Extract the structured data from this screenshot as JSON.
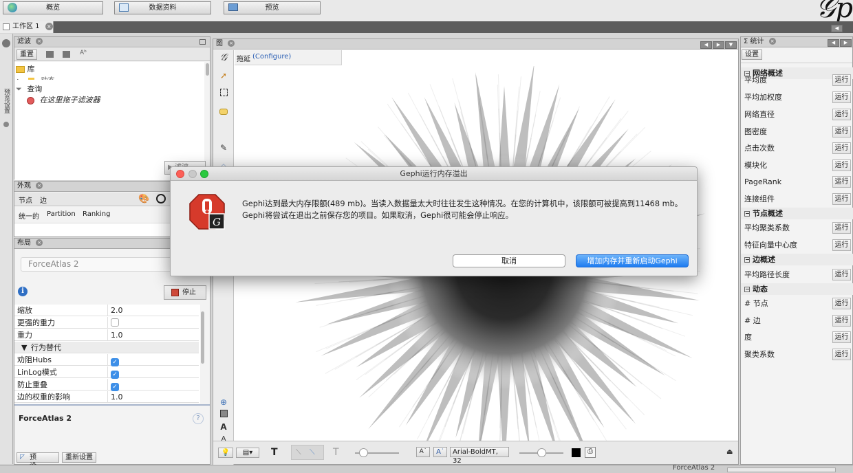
{
  "toolbar": {
    "overview": "概览",
    "data_lab": "数据资料",
    "preview": "预览"
  },
  "workspace": {
    "tab": "工作区 1"
  },
  "left_strip": {
    "label": "预览设置"
  },
  "filters": {
    "title": "滤波",
    "reset": "重置",
    "tree_library": "库",
    "tree_dynamic": "动态",
    "tree_query": "查询",
    "drag_hint": "在这里拖子滤波器",
    "filter_button": "滤波"
  },
  "appearance": {
    "title": "外观",
    "tab_nodes": "节点",
    "tab_edges": "边",
    "mode_unique": "统一的",
    "mode_partition": "Partition",
    "mode_ranking": "Ranking"
  },
  "layout": {
    "title": "布局",
    "algorithm": "ForceAtlas 2",
    "stop": "停止",
    "props": [
      {
        "key": "缩放",
        "value": "2.0"
      },
      {
        "key": "更强的重力",
        "value": ""
      },
      {
        "key": "重力",
        "value": "1.0"
      },
      {
        "key": "行为替代",
        "value": ""
      },
      {
        "key": "劝阻Hubs",
        "value": ""
      },
      {
        "key": "LinLog模式",
        "value": ""
      },
      {
        "key": "防止重叠",
        "value": ""
      },
      {
        "key": "边的权重的影响",
        "value": "1.0"
      }
    ],
    "desc_title": "ForceAtlas 2",
    "preset": "预设......",
    "reset": "重新设置"
  },
  "graph": {
    "title": "图",
    "mode_label": "拖延",
    "configure": "(Configure)",
    "font_field": "Arial-BoldMT, 32"
  },
  "statistics": {
    "title": "统计",
    "settings": "设置",
    "run": "运行",
    "sections": [
      {
        "title": "网络概述",
        "items": [
          "平均度",
          "平均加权度",
          "网络直径",
          "图密度",
          "点击次数",
          "模块化",
          "PageRank",
          "连接组件"
        ]
      },
      {
        "title": "节点概述",
        "items": [
          "平均聚类系数",
          "特征向量中心度"
        ]
      },
      {
        "title": "边概述",
        "items": [
          "平均路径长度"
        ]
      },
      {
        "title": "动态",
        "items": [
          "# 节点",
          "# 边",
          "度",
          "聚类系数"
        ]
      }
    ]
  },
  "dialog": {
    "title": "Gephi运行内存溢出",
    "message": "Gephi达到最大内存限额(489 mb)。当读入数据量太大时往往发生这种情况。在您的计算机中，该限额可被提高到11468 mb。Gephi将尝试在退出之前保存您的项目。如果取消，Gephi很可能会停止响应。",
    "cancel": "取消",
    "restart": "增加内存并重新启动Gephi"
  },
  "status": {
    "text": "ForceAtlas 2"
  }
}
